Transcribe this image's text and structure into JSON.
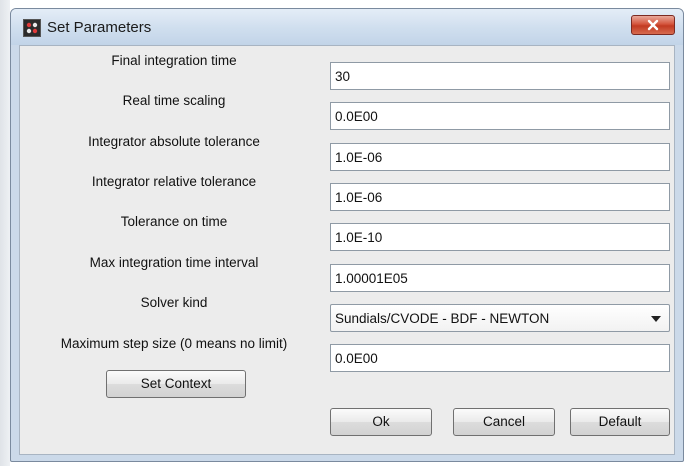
{
  "window": {
    "title": "Set Parameters",
    "app_icon": "palette-icon",
    "close_icon": "close-icon"
  },
  "fields": [
    {
      "label": "Final integration time",
      "value": "30"
    },
    {
      "label": "Real time scaling",
      "value": "0.0E00"
    },
    {
      "label": "Integrator absolute tolerance",
      "value": "1.0E-06"
    },
    {
      "label": "Integrator relative tolerance",
      "value": "1.0E-06"
    },
    {
      "label": "Tolerance on time",
      "value": "1.0E-10"
    },
    {
      "label": "Max integration time interval",
      "value": "1.00001E05"
    }
  ],
  "solver": {
    "label": "Solver kind",
    "selected": "Sundials/CVODE - BDF - NEWTON",
    "dropdown_icon": "chevron-down-icon"
  },
  "max_step": {
    "label": "Maximum step size (0 means no limit)",
    "value": "0.0E00"
  },
  "buttons": {
    "set_context": "Set Context",
    "ok": "Ok",
    "cancel": "Cancel",
    "default": "Default"
  },
  "colors": {
    "close_button": "#c84630",
    "titlebar": "#cfdeee",
    "client_background": "#ececec"
  }
}
